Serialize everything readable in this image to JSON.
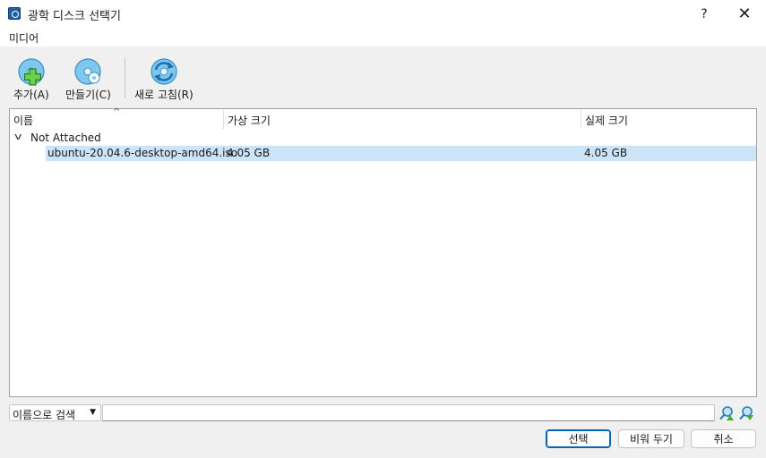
{
  "window": {
    "title": "광학 디스크 선택기",
    "help": "?",
    "close": "✕"
  },
  "menu": {
    "media": "미디어"
  },
  "toolbar": {
    "add": "추가(A)",
    "create": "만들기(C)",
    "refresh": "새로 고침(R)"
  },
  "table": {
    "columns": [
      "이름",
      "가상 크기",
      "실제 크기"
    ],
    "group": "Not Attached",
    "rows": [
      {
        "name": "ubuntu-20.04.6-desktop-amd64.iso",
        "virtual_size": "4.05 GB",
        "actual_size": "4.05 GB",
        "selected": true
      }
    ]
  },
  "search": {
    "mode": "이름으로 검색",
    "value": ""
  },
  "buttons": {
    "choose": "선택",
    "clear": "비워 두기",
    "cancel": "취소"
  },
  "colors": {
    "selection": "#cce4f7",
    "primary_border": "#0067c0"
  }
}
